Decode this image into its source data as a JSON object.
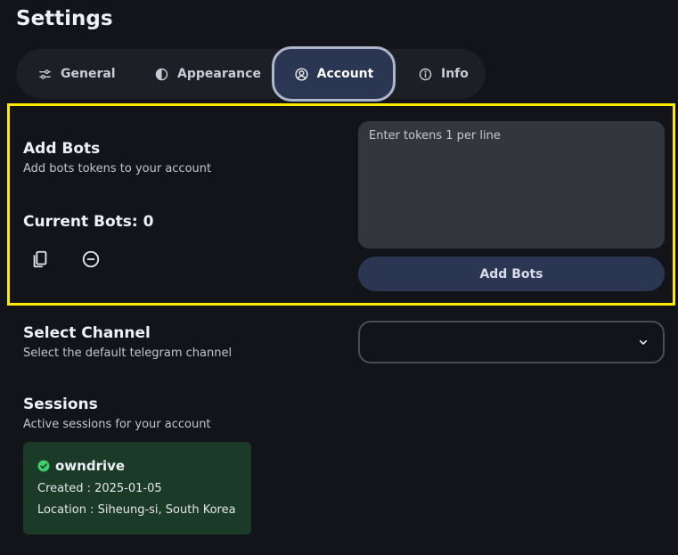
{
  "page": {
    "title": "Settings"
  },
  "tabs": [
    {
      "label": "General",
      "icon": "sliders-icon"
    },
    {
      "label": "Appearance",
      "icon": "contrast-icon"
    },
    {
      "label": "Account",
      "icon": "user-circle-icon",
      "active": true
    },
    {
      "label": "Info",
      "icon": "info-icon"
    }
  ],
  "add_bots": {
    "title": "Add Bots",
    "subtitle": "Add bots tokens to your account",
    "current_label": "Current Bots: 0",
    "tokens_placeholder": "Enter tokens 1 per line",
    "button_label": "Add Bots",
    "icons": [
      "copy-icon",
      "remove-icon"
    ]
  },
  "select_channel": {
    "title": "Select Channel",
    "subtitle": "Select the default telegram channel",
    "selected_value": ""
  },
  "sessions": {
    "title": "Sessions",
    "subtitle": "Active sessions for your account",
    "items": [
      {
        "name": "owndrive",
        "created": "Created : 2025-01-05",
        "location": "Location : Siheung-si, South Korea"
      }
    ]
  },
  "colors": {
    "background": "#131419",
    "active_tab": "#2b3652",
    "highlight": "#ffea00",
    "session_card": "#1c3a28",
    "status_ok": "#3ecf6e"
  }
}
